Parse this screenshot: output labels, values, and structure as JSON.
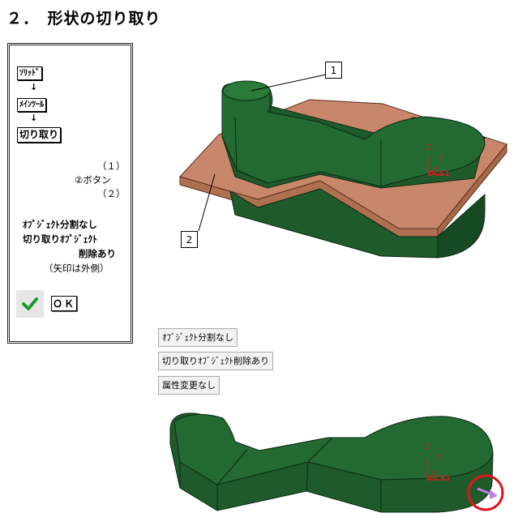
{
  "title": "２．　形状の切り取り",
  "panel": {
    "menu": [
      "ｿﾘｯﾄﾞ",
      "ﾒｲﾝﾂｰﾙ",
      "切り取り"
    ],
    "arrow": "↓",
    "step1": "（１）",
    "step_button": "②ボタン",
    "step2": "（２）",
    "note_lines": [
      "ｵﾌﾞｼﾞｪｸﾄ分割なし",
      "切り取りｵﾌﾞｼﾞｪｸﾄ",
      "削除あり"
    ],
    "note_paren": "（矢印は外側）",
    "ok_label": "ＯＫ"
  },
  "options": [
    "ｵﾌﾞｼﾞｪｸﾄ分割なし",
    "切り取りｵﾌﾞｼﾞｪｸﾄ削除あり",
    "属性変更なし"
  ],
  "callouts": [
    "1",
    "2"
  ],
  "axis": {
    "z": "Z",
    "y": "Y",
    "ucs": "UCS1"
  },
  "colors": {
    "solid_green": "#1e5a2a",
    "plate_brown": "#c8866a",
    "highlight_circle": "#e0141e",
    "arrow_violet": "#c080e0"
  }
}
